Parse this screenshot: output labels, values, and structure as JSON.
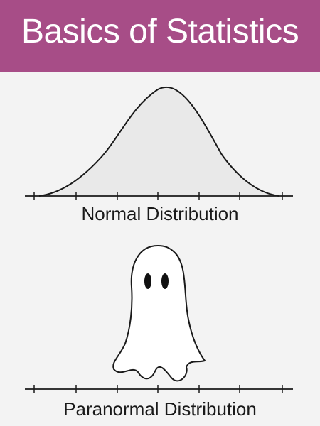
{
  "banner": {
    "title": "Basics of Statistics",
    "background_color": "#a74d87",
    "text_color": "#ffffff"
  },
  "normal_panel": {
    "caption": "Normal Distribution",
    "curve_fill": "#e9e9e9",
    "curve_stroke": "#1a1a1a"
  },
  "paranormal_panel": {
    "caption": "Paranormal Distribution",
    "figure": "ghost-icon",
    "ghost_fill": "#ffffff",
    "ghost_stroke": "#1a1a1a"
  }
}
